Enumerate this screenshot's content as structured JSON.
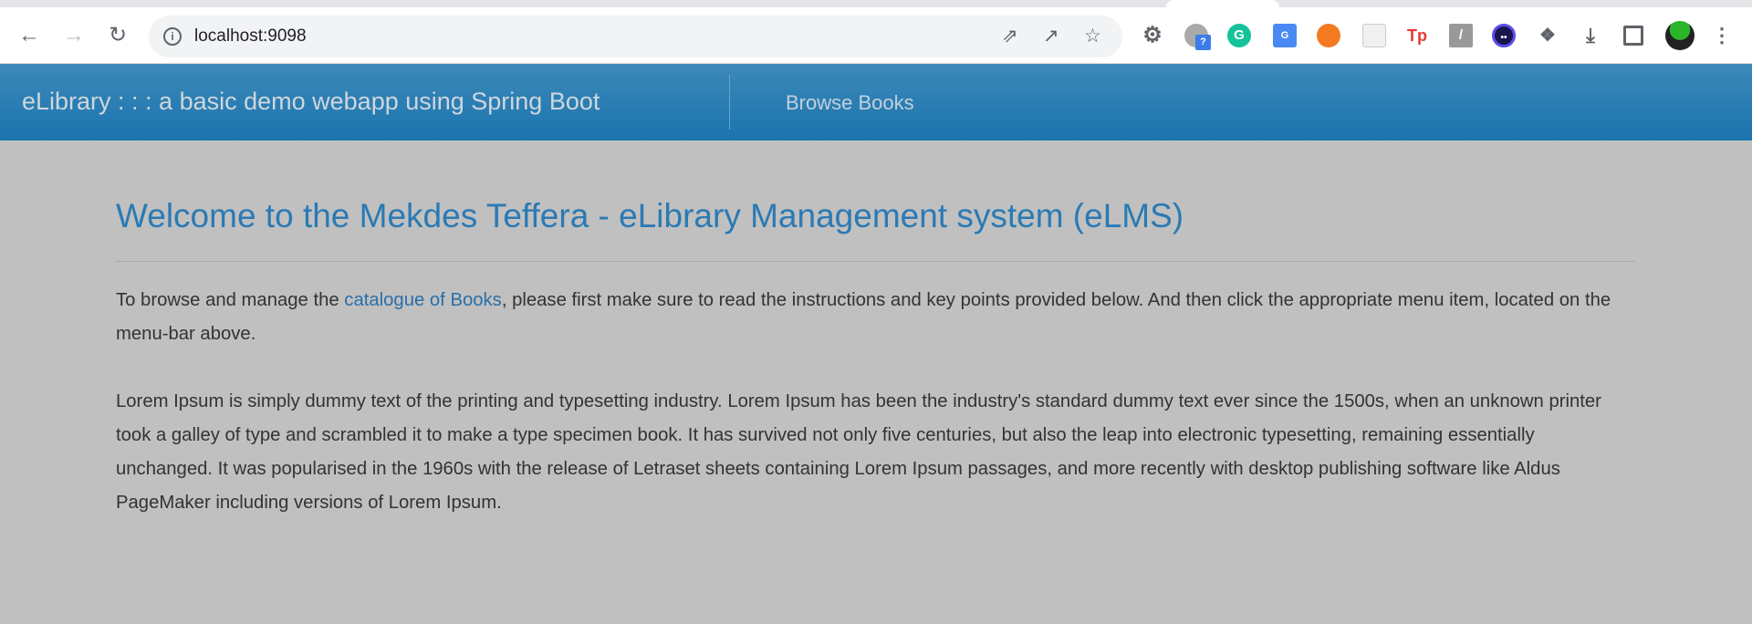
{
  "browser": {
    "url": "localhost:9098",
    "extensions": [
      "settings-icon",
      "chat-bubble-icon",
      "grammarly-icon",
      "google-translate-icon",
      "orange-extension-icon",
      "pocket-icon",
      "tp-icon",
      "stack-icon",
      "face-icon",
      "puzzle-icon",
      "download-icon",
      "sidepanel-icon",
      "profile-avatar",
      "menu-icon"
    ],
    "tp_label": "Tp",
    "grammarly_label": "G",
    "badge_label": "?"
  },
  "navbar": {
    "brand": "eLibrary : : : a basic demo webapp using Spring Boot",
    "browse_books": "Browse Books"
  },
  "main": {
    "title": "Welcome to the Mekdes Teffera - eLibrary Management system (eLMS)",
    "intro_before": "To browse and manage the ",
    "intro_link": "catalogue of Books",
    "intro_after": ", please first make sure to read the instructions and key points provided below. And then click the appropriate menu item, located on the menu-bar above.",
    "lorem": "Lorem Ipsum is simply dummy text of the printing and typesetting industry. Lorem Ipsum has been the industry's standard dummy text ever since the 1500s, when an unknown printer took a galley of type and scrambled it to make a type specimen book. It has survived not only five centuries, but also the leap into electronic typesetting, remaining essentially unchanged. It was popularised in the 1960s with the release of Letraset sheets containing Lorem Ipsum passages, and more recently with desktop publishing software like Aldus PageMaker including versions of Lorem Ipsum."
  },
  "colors": {
    "header": "#2a7fb3",
    "title": "#2a7ab4",
    "background": "#c0c0c0"
  }
}
